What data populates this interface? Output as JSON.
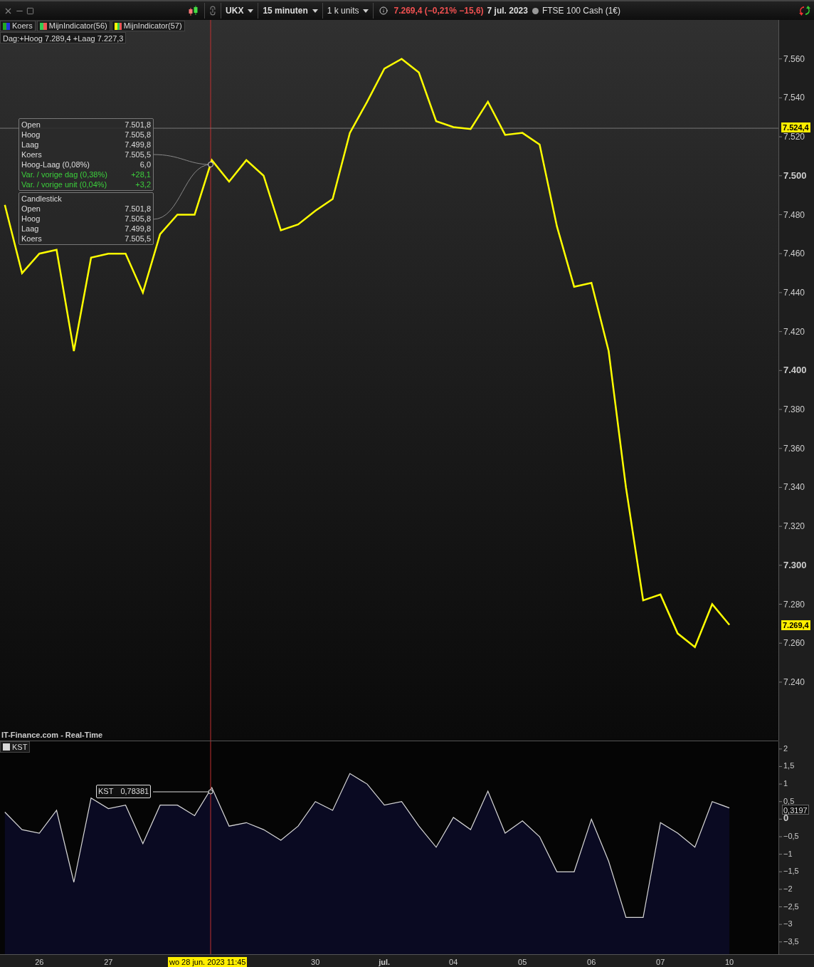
{
  "toolbar": {
    "dropdowns": [
      {
        "label": "UKX"
      },
      {
        "label": "15 minuten"
      },
      {
        "label": "1 k units"
      }
    ],
    "price_change": "7.269,4 (−0,21% −15,6)",
    "date": "7 jul. 2023",
    "instrument": "FTSE 100 Cash (1€)"
  },
  "legend": [
    {
      "label": "Koers"
    },
    {
      "label": "MijnIndicator(56)"
    }
  ],
  "day_range": "Dag:+Hoog 7.289,4 +Laag 7.227,3",
  "tooltip": {
    "rows": [
      {
        "label": "Open",
        "value": "7.501,8",
        "kind": "plain"
      },
      {
        "label": "Hoog",
        "value": "7.505,8",
        "kind": "plain"
      },
      {
        "label": "Laag",
        "value": "7.499,8",
        "kind": "plain"
      },
      {
        "label": "Koers",
        "value": "7.505,5",
        "kind": "plain"
      },
      {
        "label": "Hoog-Laag (0,08%)",
        "value": "6,0",
        "kind": "plain"
      },
      {
        "label": "Var. / vorige dag (0,38%)",
        "value": "+28,1",
        "kind": "change"
      },
      {
        "label": "Var. / vorige unit (0,04%)",
        "value": "+3,2",
        "kind": "change"
      }
    ],
    "candle_title": "Candlestick",
    "candle_rows": [
      {
        "label": "Open",
        "value": "7.501,8"
      },
      {
        "label": "Hoog",
        "value": "7.505,8"
      },
      {
        "label": "Laag",
        "value": "7.499,8"
      },
      {
        "label": "Koers",
        "value": "7.505,5"
      }
    ]
  },
  "price_panel": {
    "crosshair_price": "7.524,4",
    "last_price": "7.269,4",
    "source": "IT-Finance.com - Real-Time",
    "chart_data": {
      "type": "line",
      "ylim": [
        7210,
        7580
      ],
      "ref_lines": [
        {
          "axis": "y",
          "value": 7524.4
        }
      ],
      "categories": [
        null,
        null,
        null,
        null,
        null,
        null,
        null,
        null,
        null,
        null,
        null,
        null,
        null,
        null,
        null,
        null,
        null,
        null,
        null,
        null,
        null,
        null,
        null,
        null,
        null,
        null,
        null,
        null,
        null,
        null,
        null,
        null,
        null,
        null,
        null,
        null,
        null,
        null,
        null,
        null,
        null,
        null,
        null
      ],
      "series": [
        {
          "name": "MijnIndicator(57)",
          "color": "#ffff00",
          "values": [
            7485,
            7450,
            7460,
            7462,
            7410,
            7458,
            7460,
            7460,
            7440,
            7470,
            7480,
            7480,
            7508,
            7497,
            7508,
            7500,
            7472,
            7475,
            7482,
            7488,
            7522,
            7538,
            7555,
            7560,
            7553,
            7528,
            7525,
            7524,
            7538,
            7521,
            7522,
            7516,
            7474,
            7443,
            7445,
            7410,
            7340,
            7282,
            7285,
            7265,
            7258,
            7280,
            7269.4
          ]
        }
      ],
      "yticks": [
        {
          "value": 7560,
          "label": "7.560"
        },
        {
          "value": 7540,
          "label": "7.540"
        },
        {
          "value": 7520,
          "label": "7.520"
        },
        {
          "value": 7500,
          "label": "7.500"
        },
        {
          "value": 7480,
          "label": "7.480"
        },
        {
          "value": 7460,
          "label": "7.460"
        },
        {
          "value": 7440,
          "label": "7.440"
        },
        {
          "value": 7420,
          "label": "7.420"
        },
        {
          "value": 7400,
          "label": "7.400"
        },
        {
          "value": 7380,
          "label": "7.380"
        },
        {
          "value": 7360,
          "label": "7.360"
        },
        {
          "value": 7340,
          "label": "7.340"
        },
        {
          "value": 7320,
          "label": "7.320"
        },
        {
          "value": 7300,
          "label": "7.300"
        },
        {
          "value": 7280,
          "label": "7.280"
        },
        {
          "value": 7260,
          "label": "7.260"
        },
        {
          "value": 7240,
          "label": "7.240"
        }
      ]
    }
  },
  "kst_panel": {
    "crosshair_label": "KST",
    "crosshair_value": "0,78381",
    "last_value": "0,3197",
    "chart_data": {
      "type": "area",
      "ylim": [
        -3.87,
        2.22
      ],
      "categories": [
        null,
        null,
        "26",
        null,
        null,
        null,
        "27",
        null,
        null,
        null,
        null,
        null,
        null,
        null,
        null,
        null,
        null,
        null,
        "30",
        null,
        null,
        null,
        "jul.",
        null,
        null,
        null,
        "04",
        null,
        null,
        null,
        "05",
        null,
        null,
        null,
        "06",
        null,
        null,
        null,
        "07",
        null,
        null,
        null,
        "10"
      ],
      "series": [
        {
          "name": "KST",
          "color": "#d8d8d8",
          "values": [
            0.2,
            -0.3,
            -0.4,
            0.25,
            -1.8,
            0.6,
            0.3,
            0.4,
            -0.7,
            0.4,
            0.4,
            0.1,
            0.9,
            -0.2,
            -0.1,
            -0.3,
            -0.6,
            -0.2,
            0.5,
            0.25,
            1.3,
            1.0,
            0.4,
            0.5,
            -0.2,
            -0.8,
            0.05,
            -0.3,
            0.8,
            -0.4,
            -0.05,
            -0.5,
            -1.5,
            -1.5,
            0,
            -1.2,
            -2.8,
            -2.8,
            -0.1,
            -0.4,
            -0.8,
            0.5,
            0.32
          ]
        }
      ],
      "yticks": [
        {
          "value": 2,
          "label": "2"
        },
        {
          "value": 1.5,
          "label": "1,5"
        },
        {
          "value": 1,
          "label": "1"
        },
        {
          "value": 0.5,
          "label": "0,5"
        },
        {
          "value": 0,
          "label": "0"
        },
        {
          "value": -0.5,
          "label": "−0,5"
        },
        {
          "value": -1,
          "label": "−1"
        },
        {
          "value": -1.5,
          "label": "−1,5"
        },
        {
          "value": -2,
          "label": "−2"
        },
        {
          "value": -2.5,
          "label": "−2,5"
        },
        {
          "value": -3,
          "label": "−3"
        },
        {
          "value": -3.5,
          "label": "−3,5"
        }
      ]
    }
  },
  "date_axis": {
    "crosshair_date": "wo 28 jun. 2023 11:45"
  }
}
